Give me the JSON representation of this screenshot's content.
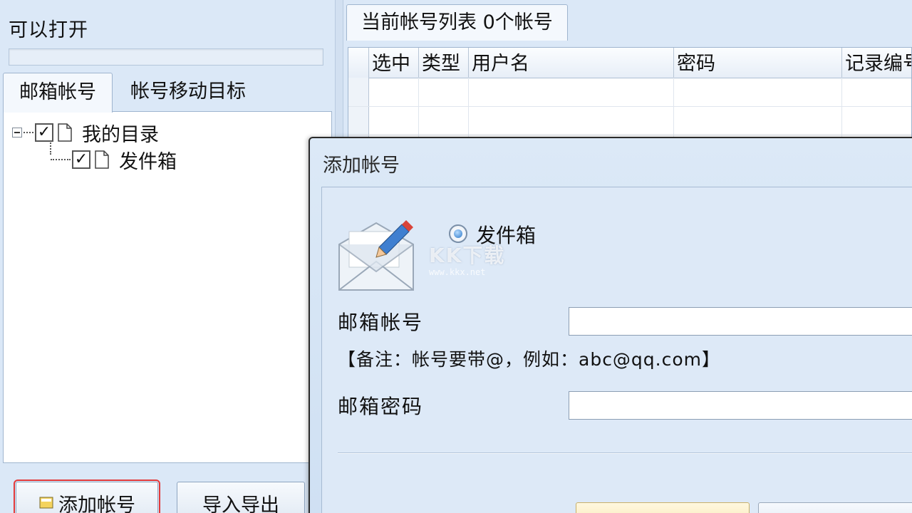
{
  "left_panel": {
    "open_label": "可以打开",
    "tabs": [
      {
        "label": "邮箱帐号",
        "active": true
      },
      {
        "label": "帐号移动目标",
        "active": false
      }
    ],
    "tree": [
      {
        "label": "我的目录",
        "checked": true,
        "check_mark": "✓"
      },
      {
        "label": "发件箱",
        "checked": true,
        "check_mark": "✓"
      }
    ],
    "buttons": {
      "add_account": "添加帐号",
      "import_export": "导入导出"
    }
  },
  "right_panel": {
    "tab_label": "当前帐号列表 0个帐号",
    "grid": {
      "columns": [
        "选中",
        "类型",
        "用户名",
        "密码",
        "记录编号"
      ],
      "rows": []
    }
  },
  "dialog": {
    "title": "添加帐号",
    "radio_option": {
      "label": "发件箱",
      "selected": true
    },
    "watermark": "KK下载",
    "watermark_url": "www.kkx.net",
    "email_label": "邮箱帐号",
    "email_value": "",
    "note": "【备注：帐号要带@，例如：abc@qq.com】",
    "password_label": "邮箱密码",
    "password_value": ""
  },
  "colors": {
    "panel_bg": "#dbe8f7",
    "highlight_border": "#e2393a",
    "dialog_border": "#2b2b2b"
  }
}
